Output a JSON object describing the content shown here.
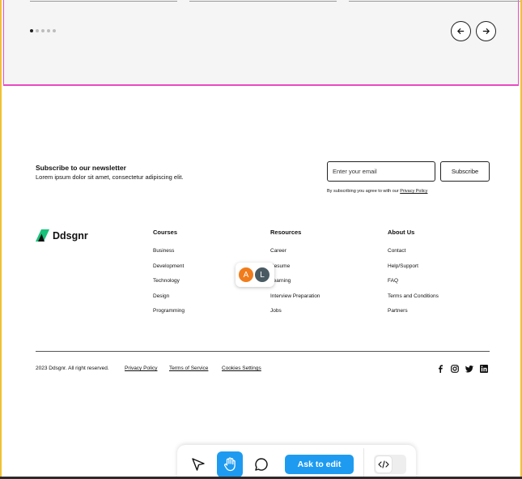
{
  "carousel": {
    "dot_count": 5,
    "active_dot": 0
  },
  "newsletter": {
    "title": "Subscribe to our newsletter",
    "description": "Lorem ipsum dolor sit amet, consectetur adipiscing elit.",
    "email_placeholder": "Enter your email",
    "subscribe_label": "Subscribe",
    "consent_prefix": "By subscribing you agree to with our",
    "consent_link": "Privacy Policy"
  },
  "logo": {
    "name": "Ddsgnr",
    "color": "#18c27a"
  },
  "columns": [
    {
      "title": "Courses",
      "links": [
        "Business",
        "Development",
        "Technology",
        "Design",
        "Programming"
      ]
    },
    {
      "title": "Resources",
      "links": [
        "Career",
        "Resume",
        "Learning",
        "Interview Preparation",
        "Jobs"
      ]
    },
    {
      "title": "About Us",
      "links": [
        "Contact",
        "Help/Support",
        "FAQ",
        "Terms and Conditions",
        "Partners"
      ]
    }
  ],
  "footer": {
    "copyright": "2023 Ddsgnr. All right reserved.",
    "privacy": "Privacy Policy",
    "terms": "Terms of Service",
    "cookies": "Cookies Settings",
    "social_icons": [
      "facebook-icon",
      "instagram-icon",
      "twitter-icon",
      "linkedin-icon"
    ]
  },
  "collaborators": [
    {
      "initial": "A",
      "color": "#f07c1b"
    },
    {
      "initial": "L",
      "color": "#4a5a63"
    }
  ],
  "toolbar": {
    "tools": [
      "cursor-icon",
      "hand-icon",
      "comment-icon"
    ],
    "active_tool": "hand-icon",
    "ask_label": "Ask to edit",
    "accent": "#1e9bf0"
  }
}
